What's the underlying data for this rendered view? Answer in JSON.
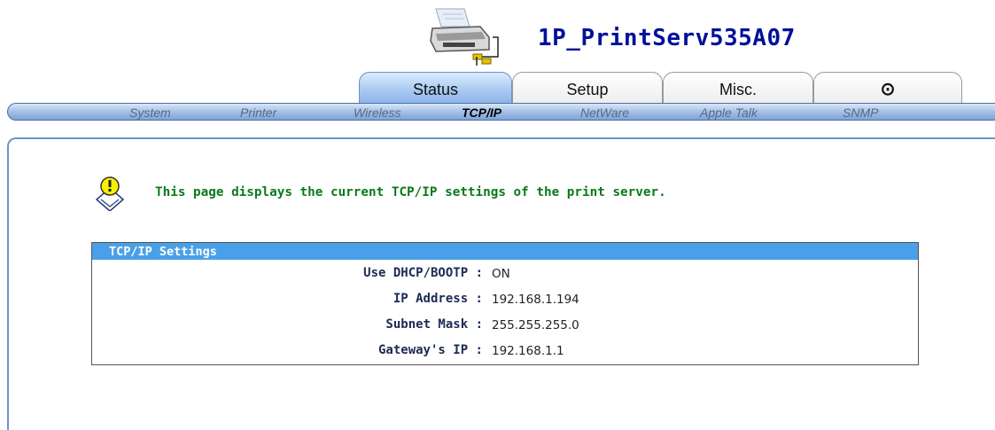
{
  "header": {
    "device_name": "1P_PrintServ535A07"
  },
  "tabs": [
    {
      "label": "Status",
      "active": true
    },
    {
      "label": "Setup",
      "active": false
    },
    {
      "label": "Misc.",
      "active": false
    },
    {
      "label": "⊙",
      "icon": "power-icon",
      "active": false
    }
  ],
  "subnav": [
    {
      "label": "System",
      "active": false
    },
    {
      "label": "Printer",
      "active": false
    },
    {
      "label": "Wireless",
      "active": false
    },
    {
      "label": "TCP/IP",
      "active": true
    },
    {
      "label": "NetWare",
      "active": false
    },
    {
      "label": "Apple Talk",
      "active": false
    },
    {
      "label": "SNMP",
      "active": false
    }
  ],
  "info": {
    "icon": "lightbulb-info-icon",
    "message": "This page displays the current TCP/IP settings of the print server."
  },
  "settings": {
    "title": "TCP/IP Settings",
    "rows": [
      {
        "label": "Use DHCP/BOOTP :",
        "value": "ON"
      },
      {
        "label": "IP Address :",
        "value": "192.168.1.194"
      },
      {
        "label": "Subnet Mask :",
        "value": "255.255.255.0"
      },
      {
        "label": "Gateway's IP :",
        "value": "192.168.1.1"
      }
    ]
  },
  "colors": {
    "title": "#00109a",
    "info_text": "#0a7a1a",
    "table_header": "#4aa0e8",
    "nav_blue": "#7ea3d7"
  }
}
